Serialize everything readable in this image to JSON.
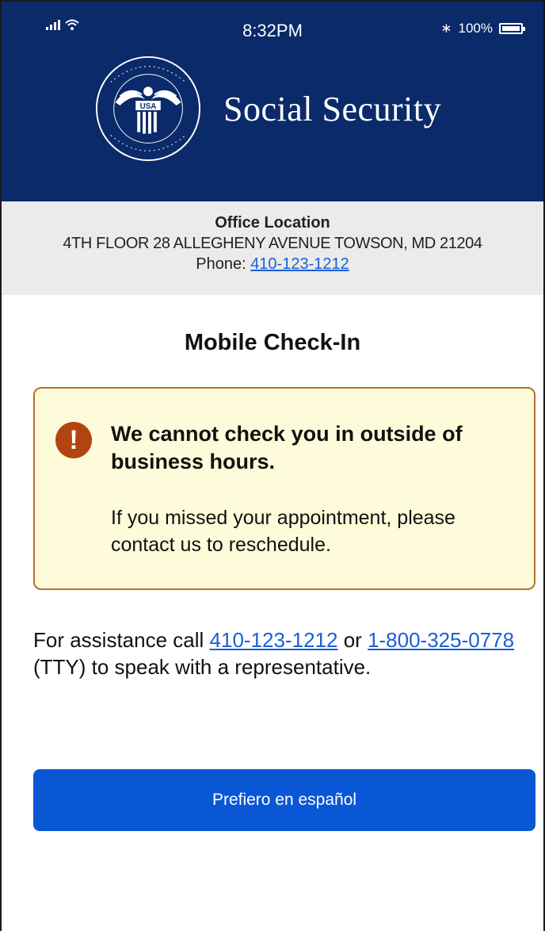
{
  "status_bar": {
    "time": "8:32PM",
    "battery": "100%",
    "bluetooth_symbol": "∗",
    "icons": [
      "signal-icon",
      "wifi-icon",
      "bluetooth-icon",
      "battery-icon"
    ]
  },
  "header": {
    "brand_name": "Social Security",
    "logo": "ssa-seal-logo",
    "background_color": "#0b2a6a"
  },
  "office": {
    "title": "Office Location",
    "address": "4TH FLOOR 28 ALLEGHENY AVENUE TOWSON, MD 21204",
    "phone_label": "Phone:",
    "phone": "410-123-1212"
  },
  "main": {
    "title": "Mobile Check-In"
  },
  "alert": {
    "icon": "exclamation-icon",
    "heading": "We cannot check you in outside of business hours.",
    "body": "If you missed your appointment, please contact us to reschedule.",
    "border_color": "#b9702b",
    "background_color": "#fdfbd9"
  },
  "assistance": {
    "prefix": "For assistance call",
    "phone": "410-123-1212",
    "or": "or",
    "tty_phone": "1-800-325-0778",
    "suffix": "(TTY) to speak with a representative."
  },
  "spanish_button": {
    "label": "Prefiero en español",
    "color": "#0a57d6"
  }
}
